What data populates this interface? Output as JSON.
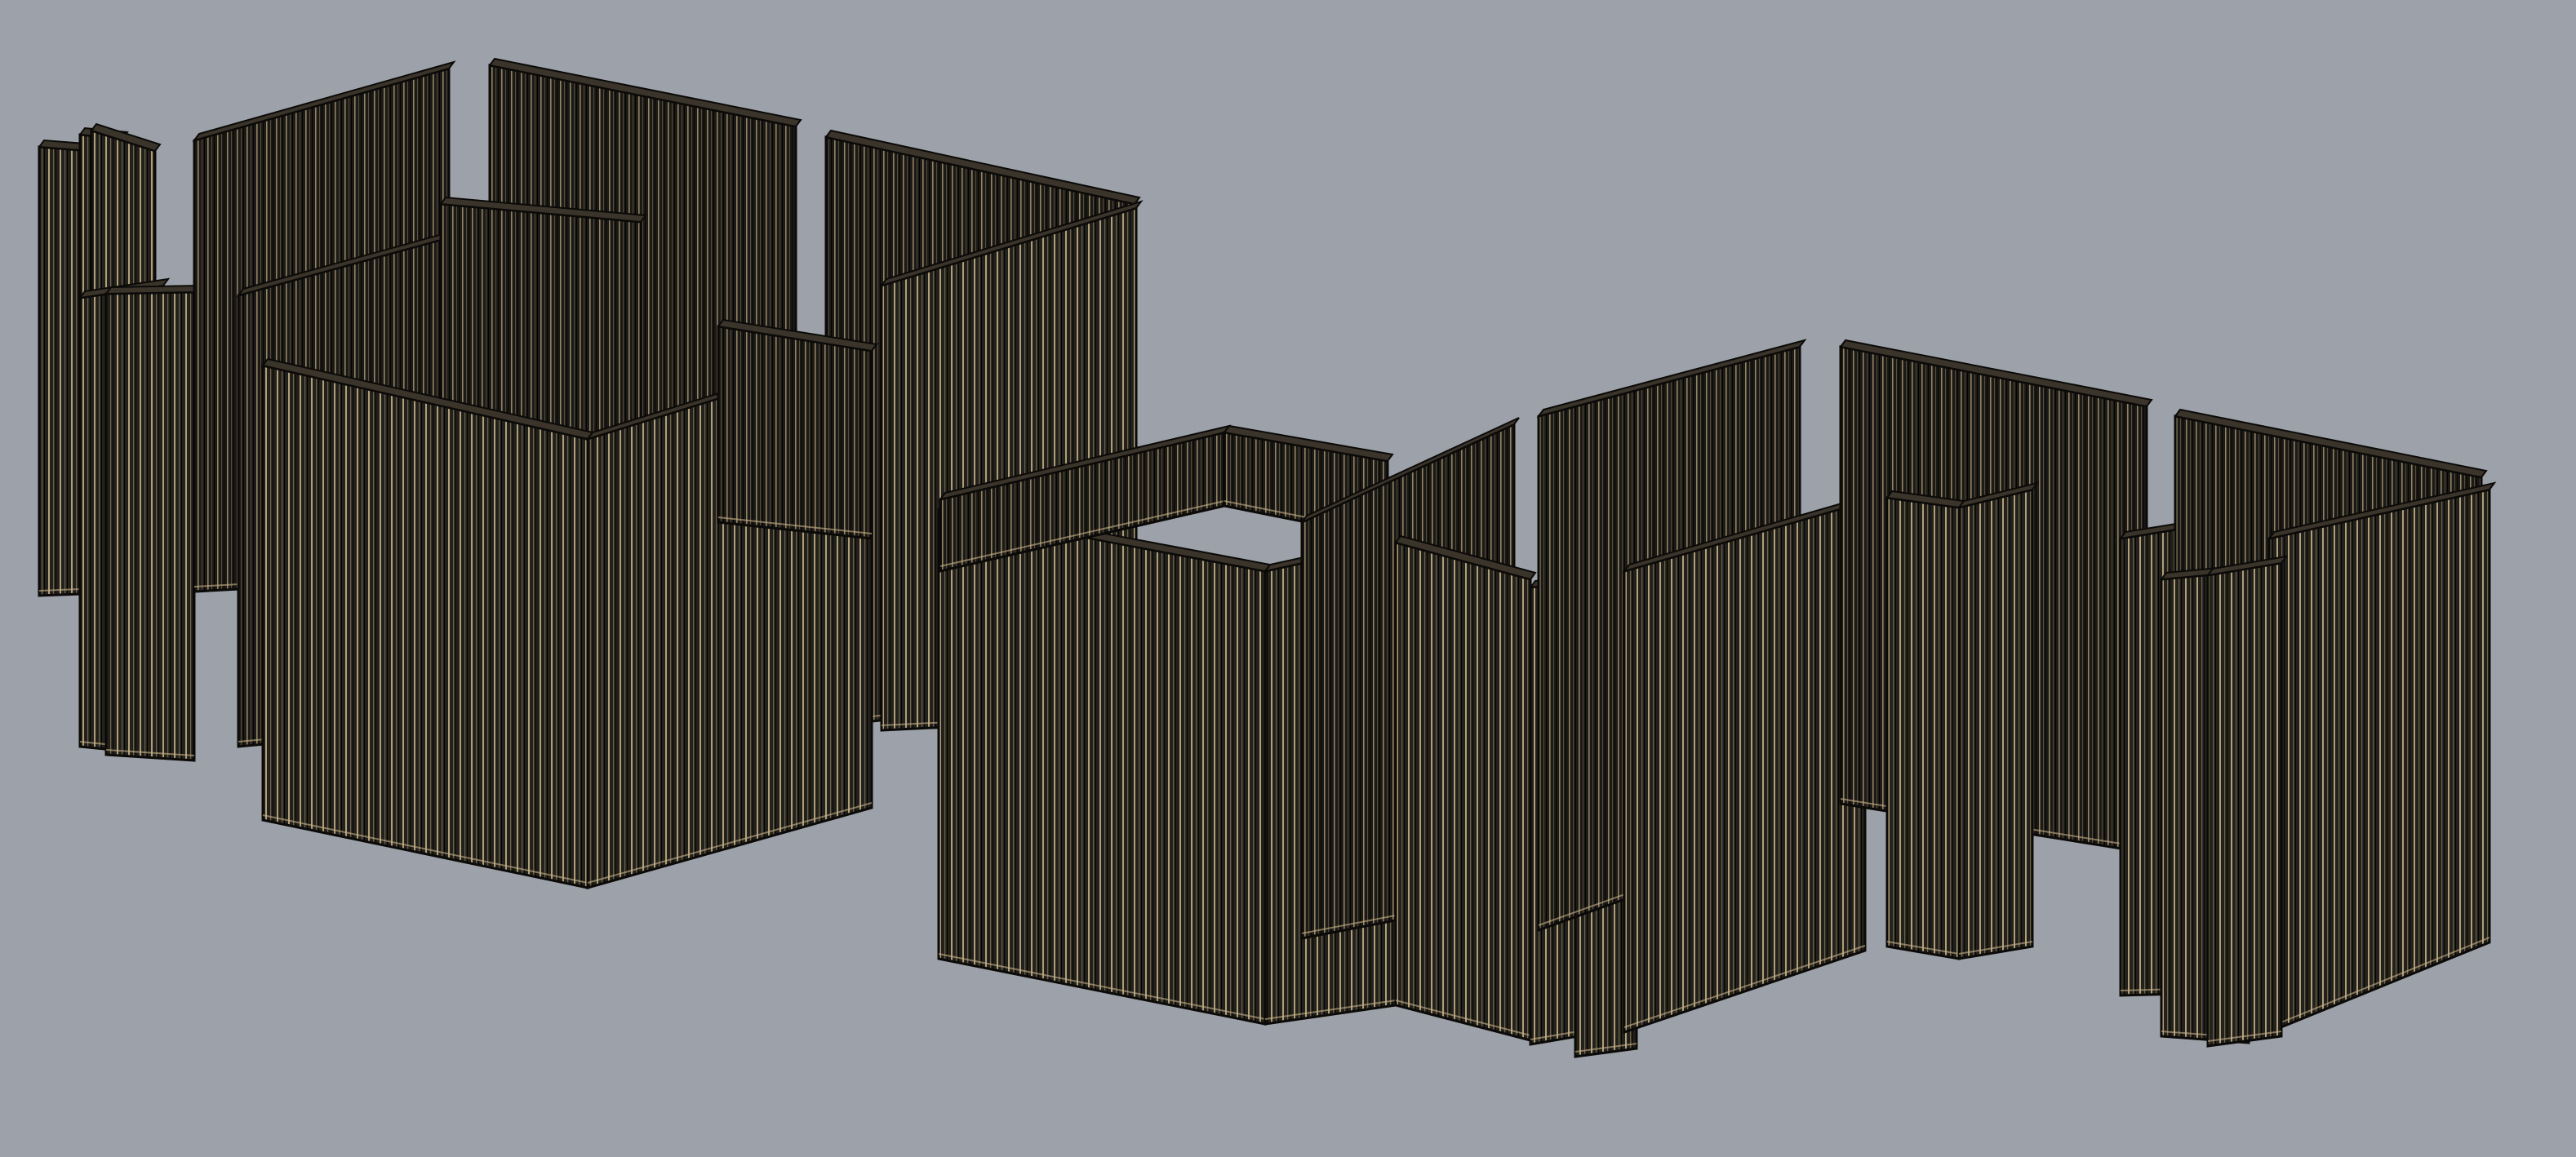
{
  "viewport": {
    "background_color": "#9da2aa",
    "view": "perspective",
    "display_mode": "wireframe"
  },
  "scene": {
    "object_type": "wall-panel-assembly",
    "colors": {
      "panel_face": "#23211c",
      "stud_line": "#c9b48a",
      "outline": "#0b0a08",
      "top_cap": "#3a342a"
    },
    "clusters": [
      {
        "id": "cluster-left",
        "wall_count": 14
      },
      {
        "id": "cluster-right",
        "wall_count": 18
      }
    ]
  }
}
